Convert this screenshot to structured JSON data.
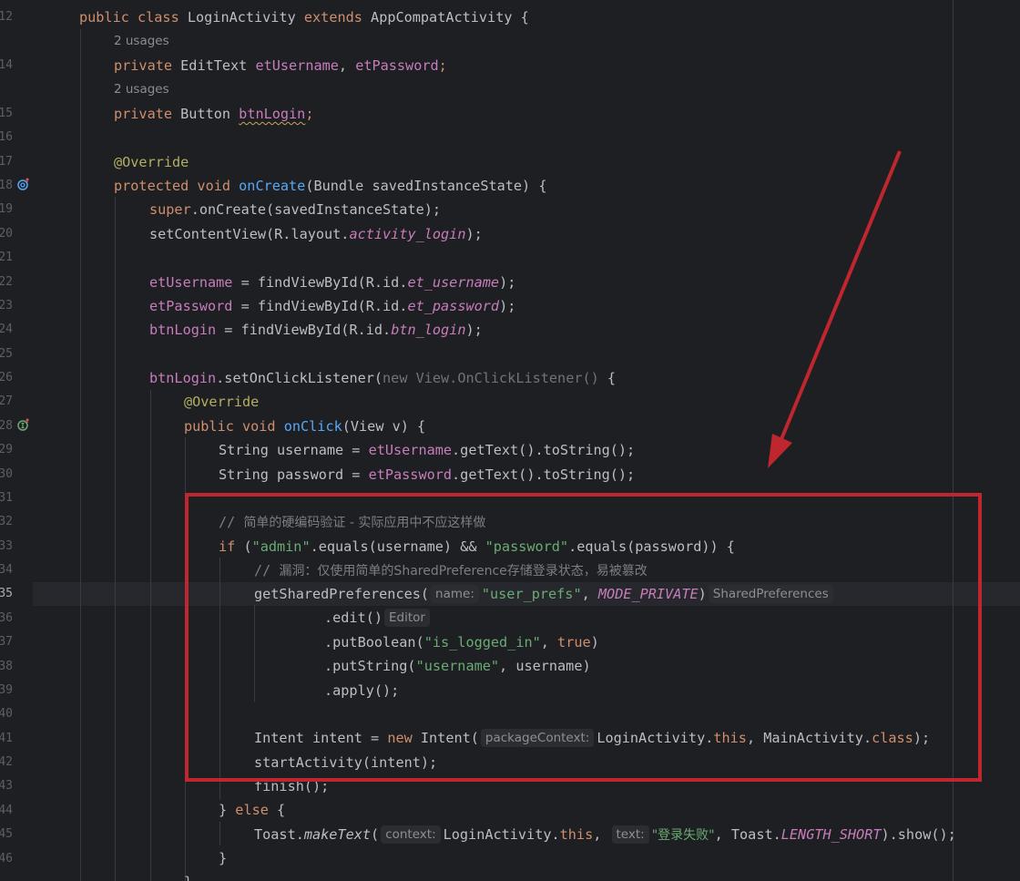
{
  "editor": {
    "usages": [
      "2 usages",
      "2 usages"
    ],
    "gutter_numbers": [
      "12",
      "14",
      "15",
      "16",
      "17",
      "18",
      "19",
      "20",
      "21",
      "22",
      "23",
      "24",
      "25",
      "26",
      "27",
      "28",
      "29",
      "30",
      "31",
      "32",
      "33",
      "34",
      "35",
      "36",
      "37",
      "38",
      "39",
      "40",
      "41",
      "42",
      "43",
      "44",
      "45",
      "46"
    ],
    "gutter_icons": [
      "override-method-icon",
      "implement-method-icon"
    ],
    "hints": {
      "name": "name:",
      "return_shared_prefs": "SharedPreferences",
      "return_editor": "Editor",
      "package_context": "packageContext:",
      "context": "context:",
      "text": "text:"
    },
    "code": {
      "l12_kw": "public class ",
      "l12_name": "LoginActivity ",
      "l12_extends": "extends ",
      "l12_rest": "AppCompatActivity {",
      "l14_kw": "private ",
      "l14_type": "EditText ",
      "l14_f1": "etUsername",
      "l14_sep": ", ",
      "l14_f2": "etPassword",
      "l14_end": ";",
      "l15_kw": "private ",
      "l15_type": "Button ",
      "l15_f": "btnLogin",
      "l15_end": ";",
      "l17_ann": "@Override",
      "l18_kw": "protected void ",
      "l18_fn": "onCreate",
      "l18_rest": "(Bundle savedInstanceState) {",
      "l19_kw": "super",
      "l19_rest": ".onCreate(savedInstanceState);",
      "l20_a": "setContentView(R.layout.",
      "l20_b": "activity_login",
      "l20_c": ");",
      "l22_f": "etUsername",
      "l22_a": " = findViewById(R.id.",
      "l22_b": "et_username",
      "l22_c": ");",
      "l23_f": "etPassword",
      "l23_a": " = findViewById(R.id.",
      "l23_b": "et_password",
      "l23_c": ");",
      "l24_f": "btnLogin",
      "l24_a": " = findViewById(R.id.",
      "l24_b": "btn_login",
      "l24_c": ");",
      "l26_f": "btnLogin",
      "l26_a": ".setOnClickListener(",
      "l26_b": "new View.OnClickListener()",
      "l26_c": " {",
      "l27_ann": "@Override",
      "l28_kw": "public void ",
      "l28_fn": "onClick",
      "l28_rest": "(View v) {",
      "l29_a": "String username = ",
      "l29_f": "etUsername",
      "l29_b": ".getText().toString();",
      "l30_a": "String password = ",
      "l30_f": "etPassword",
      "l30_b": ".getText().toString();",
      "l32_a": "// ",
      "l32_b": "简单的硬编码验证 - 实际应用中不应这样做",
      "l33_kw": "if ",
      "l33_a": "(",
      "l33_s1": "\"admin\"",
      "l33_b": ".equals(username) && ",
      "l33_s2": "\"password\"",
      "l33_c": ".equals(password)) {",
      "l34_a": "// ",
      "l34_b": "漏洞：仅使用简单的SharedPreference存储登录状态，易被篡改",
      "l35_a": "getSharedPreferences(",
      "l35_s": "\"user_prefs\"",
      "l35_b": ", ",
      "l35_f": "MODE_PRIVATE",
      "l35_c": ")",
      "l36_a": ".edit()",
      "l37_a": ".putBoolean(",
      "l37_s": "\"is_logged_in\"",
      "l37_b": ", ",
      "l37_kw": "true",
      "l37_c": ")",
      "l38_a": ".putString(",
      "l38_s": "\"username\"",
      "l38_b": ", username)",
      "l39_a": ".apply();",
      "l41_a": "Intent intent = ",
      "l41_kw": "new ",
      "l41_b": "Intent(",
      "l41_c": "LoginActivity.",
      "l41_this": "this",
      "l41_d": ", MainActivity.",
      "l41_class": "class",
      "l41_e": ");",
      "l42_a": "startActivity(intent);",
      "l43_a": "finish();",
      "l44_a": "} ",
      "l44_kw": "else ",
      "l44_b": "{",
      "l45_a": "Toast.",
      "l45_fn": "makeText",
      "l45_b": "(",
      "l45_c": "LoginActivity.",
      "l45_this": "this",
      "l45_d": ", ",
      "l45_s": "\"登录失败\"",
      "l45_e": ", Toast.",
      "l45_f": "LENGTH_SHORT",
      "l45_g": ").show();",
      "l46_a": "}",
      "l47_a": "}"
    }
  },
  "colors": {
    "background": "#1e1f22",
    "keyword": "#cf8e6d",
    "field": "#c77dbb",
    "method": "#56a8f5",
    "string": "#6aab73",
    "annotation": "#b3ae60",
    "comment": "#7a7e85",
    "annotation_overlay": "#c0262d"
  }
}
